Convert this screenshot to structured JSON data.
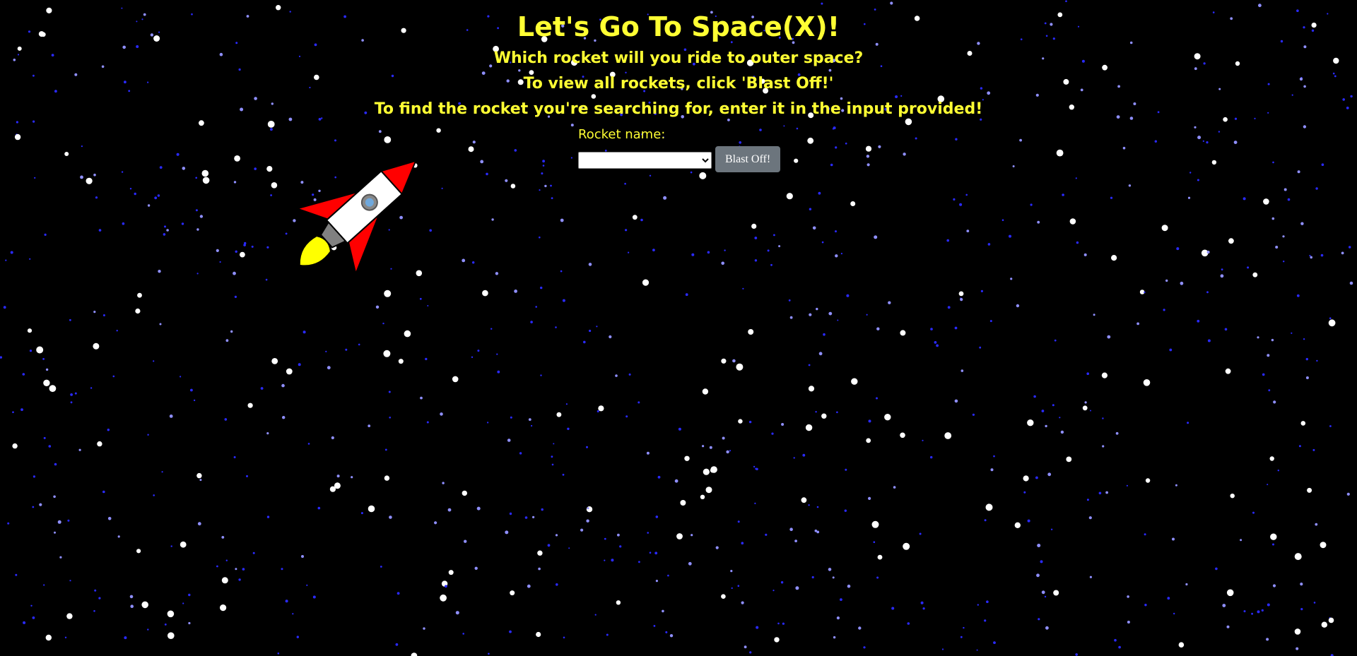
{
  "page": {
    "title": "Let's Go To Space(X)!",
    "lines": [
      "Which rocket will you ride to outer space?",
      "To view all rockets, click 'Blast Off!'",
      "To find the rocket you're searching for, enter it in the input provided!"
    ]
  },
  "form": {
    "label": "Rocket name:",
    "select_value": "",
    "button_label": "Blast Off!"
  },
  "colors": {
    "background": "#000000",
    "text": "#ffff33",
    "button": "#6c757d",
    "rocket_fins": "#ff0000",
    "rocket_body": "#ffffff",
    "rocket_flame": "#ffff00"
  },
  "icons": {
    "rocket": "rocket-icon",
    "select_arrow": "chevron-down-icon"
  }
}
